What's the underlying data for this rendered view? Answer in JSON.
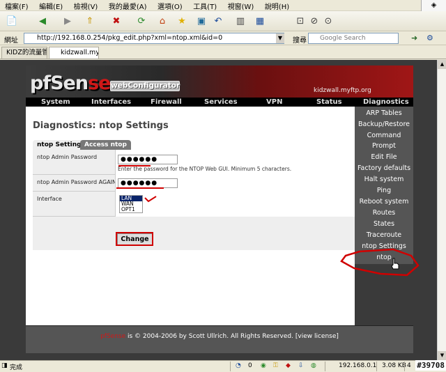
{
  "browser": {
    "menu": [
      "檔案(F)",
      "編輯(E)",
      "檢視(V)",
      "我的最愛(A)",
      "選項(O)",
      "工具(T)",
      "視窗(W)",
      "說明(H)"
    ],
    "address_label": "網址",
    "url": "http://192.168.0.254/pkg_edit.php?xml=ntop.xml&id=0",
    "search_label": "搜尋",
    "search_placeholder": "Google Search",
    "tabs": [
      {
        "title": "KIDZ的流量管..."
      },
      {
        "title": "kidzwall.myft..."
      }
    ]
  },
  "header": {
    "logo_prefix": "pf",
    "logo_main": "Sen",
    "logo_accent": "se",
    "badge": "webConfigurator",
    "hostname": "kidzwall.myftp.org"
  },
  "nav": [
    "System",
    "Interfaces",
    "Firewall",
    "Services",
    "VPN",
    "Status",
    "Diagnostics"
  ],
  "page": {
    "title": "Diagnostics: ntop Settings",
    "tabs": [
      {
        "label": "ntop Settings",
        "active": true
      },
      {
        "label": "Access ntop",
        "active": false
      }
    ],
    "fields": {
      "password": {
        "label": "ntop Admin Password",
        "value": "●●●●●●",
        "hint": "Enter the password for the NTOP Web GUI. Minimum 5 characters."
      },
      "password_again": {
        "label": "ntop Admin Password AGAIN",
        "value": "●●●●●●"
      },
      "interface": {
        "label": "Interface",
        "options": [
          "LAN",
          "WAN",
          "OPT1"
        ],
        "selected": "LAN"
      }
    },
    "change_button": "Change"
  },
  "sidebar": [
    "ARP Tables",
    "Backup/Restore",
    "Command",
    "Prompt",
    "Edit File",
    "Factory defaults",
    "Halt system",
    "Ping",
    "Reboot system",
    "Routes",
    "States",
    "Traceroute",
    "ntop Settings",
    "ntop"
  ],
  "footer": {
    "brand": "pfSense",
    "text": " is © 2004-2006 by Scott Ullrich. All Rights Reserved. [",
    "link": "view license",
    "end": "]"
  },
  "statusbar": {
    "status": "完成",
    "count": "0",
    "ip": "192.168.0.1",
    "size": "3.08 KB",
    "page": "4"
  },
  "watermark": "#39708",
  "colors": {
    "accent_red": "#d00000",
    "content_bg": "#ffffff",
    "sidebar_bg": "#555555"
  }
}
